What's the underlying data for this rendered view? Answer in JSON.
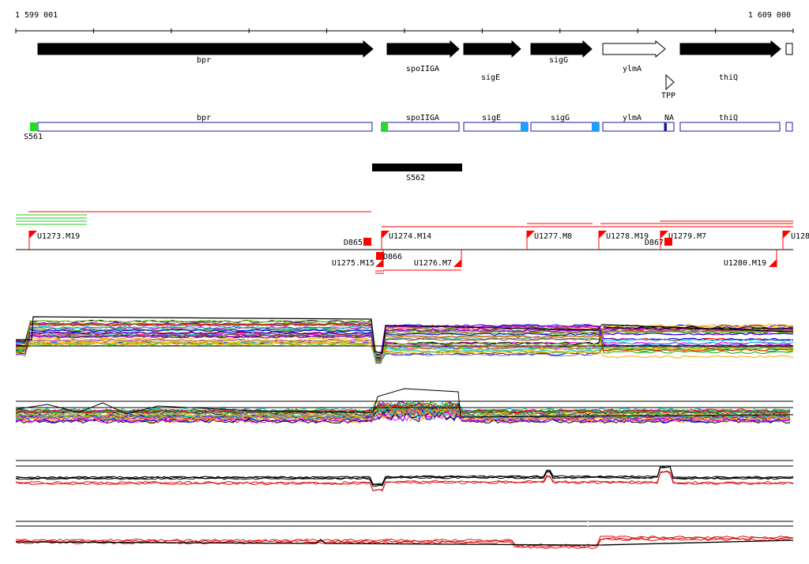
{
  "ruler": {
    "start_label": "1 599 001",
    "end_label": "1 609 000"
  },
  "genes": [
    {
      "label": "bpr",
      "fill": "#000000",
      "dir": "right"
    },
    {
      "label": "spoIIGA",
      "fill": "#000000",
      "dir": "right"
    },
    {
      "label": "sigE",
      "fill": "#000000",
      "dir": "right"
    },
    {
      "label": "sigG",
      "fill": "#000000",
      "dir": "right"
    },
    {
      "label": "ylmA",
      "fill": "#ffffff",
      "dir": "right"
    },
    {
      "label": "thiQ",
      "fill": "#000000",
      "dir": "right"
    }
  ],
  "riboswitch": {
    "label": "TPP"
  },
  "transcripts": [
    {
      "label": "bpr"
    },
    {
      "label": "spoIIGA"
    },
    {
      "label": "sigE"
    },
    {
      "label": "sigG"
    },
    {
      "label": "ylmA"
    },
    {
      "label": "NA"
    },
    {
      "label": "thiQ"
    }
  ],
  "segments": [
    {
      "label": "S561"
    },
    {
      "label": "S562"
    }
  ],
  "upshifts": [
    {
      "label": "U1273.M19"
    },
    {
      "label": "U1274.M14"
    },
    {
      "label": "U1277.M8"
    },
    {
      "label": "U1278.M19"
    },
    {
      "label": "U1279.M7"
    },
    {
      "label": "U128"
    },
    {
      "label": "U1275.M15"
    },
    {
      "label": "U1276.M7"
    },
    {
      "label": "U1280.M19"
    }
  ],
  "downshifts": [
    {
      "label": "D865"
    },
    {
      "label": "D866"
    },
    {
      "label": "D867"
    }
  ],
  "colors": {
    "transcript_outline": "#1a1aa0",
    "green_marker": "#22dd22",
    "blue_marker": "#1aa0ff",
    "shift_red": "#ff0000",
    "profile_red": "#dd1111",
    "profile_black": "#000000"
  },
  "profile_palette": [
    "#ff0000",
    "#00aa00",
    "#0000ff",
    "#ff00ff",
    "#00cccc",
    "#ffa500",
    "#888888",
    "#8b4513",
    "#9400d3",
    "#66cc00",
    "#ffcc00",
    "#000000"
  ]
}
